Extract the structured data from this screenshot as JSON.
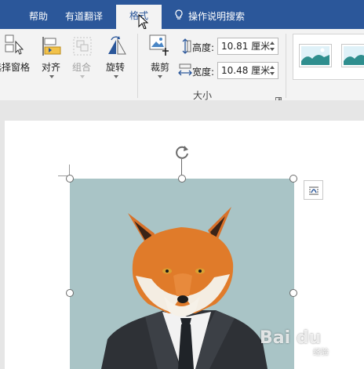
{
  "tabs": {
    "help": "帮助",
    "youdao": "有道翻译",
    "format": "格式",
    "tellme": "操作说明搜索"
  },
  "ribbon": {
    "selection_pane": "选择窗格",
    "align": "对齐",
    "group": "组合",
    "rotate": "旋转",
    "crop": "裁剪",
    "height_label": "高度:",
    "height_value": "10.81 厘米",
    "width_label": "宽度:",
    "width_value": "10.48 厘米",
    "size_group": "大小"
  },
  "watermark": {
    "brand": "Bai du",
    "sub": "经验"
  },
  "colors": {
    "tab_bar": "#2b579a",
    "ribbon": "#f3f3f3",
    "photo_background": "#a9c4c6",
    "fox_fur": "#e07b2a",
    "jacket": "#2e3136"
  },
  "icons": [
    "lightbulb-icon",
    "selection-pane-icon",
    "align-icon",
    "group-icon",
    "rotate-icon",
    "crop-icon",
    "height-icon",
    "width-icon",
    "dialog-launcher-icon",
    "layout-options-icon",
    "rotate-handle-icon",
    "mouse-cursor-icon"
  ]
}
